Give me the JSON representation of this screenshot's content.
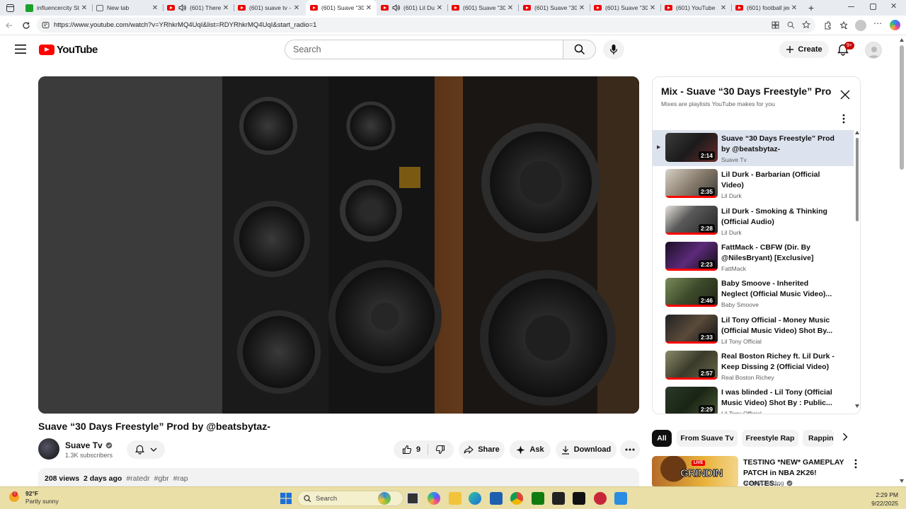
{
  "browser": {
    "tabs": [
      {
        "label": "influencercity St",
        "icon": "k-icon",
        "active": false
      },
      {
        "label": "New tab",
        "icon": "newtab-icon",
        "active": false
      },
      {
        "label": "(601) There",
        "icon": "youtube-icon",
        "audio": true,
        "active": false
      },
      {
        "label": "(601) suave tv - Y",
        "icon": "youtube-icon",
        "active": false
      },
      {
        "label": "(601) Suave “30",
        "icon": "youtube-icon",
        "active": true
      },
      {
        "label": "(601) Lil Du",
        "icon": "youtube-icon",
        "audio": true,
        "active": false
      },
      {
        "label": "(601) Suave “30",
        "icon": "youtube-icon",
        "active": false
      },
      {
        "label": "(601) Suave “30",
        "icon": "youtube-icon",
        "active": false
      },
      {
        "label": "(601) Suave “30",
        "icon": "youtube-icon",
        "active": false
      },
      {
        "label": "(601) YouTube",
        "icon": "youtube-icon",
        "active": false
      },
      {
        "label": "(601) football jer",
        "icon": "youtube-icon",
        "active": false
      }
    ],
    "close_glyph": "✕",
    "new_tab_glyph": "+",
    "url": "https://www.youtube.com/watch?v=YRhkrMQ4UqI&list=RDYRhkrMQ4UqI&start_radio=1"
  },
  "header": {
    "logo_text": "YouTube",
    "search_placeholder": "Search",
    "create_label": "Create",
    "notification_count": "9+"
  },
  "video": {
    "title": "Suave “30 Days Freestyle” Prod by @beatsbytaz-",
    "channel": "Suave Tv",
    "subscribers": "1.3K subscribers",
    "likes": "9",
    "share_label": "Share",
    "ask_label": "Ask",
    "download_label": "Download",
    "views": "208 views",
    "age": "2 days ago",
    "tags": [
      "#ratedr",
      "#gbr",
      "#rap"
    ]
  },
  "playlist": {
    "title": "Mix - Suave “30 Days Freestyle” Pro...",
    "subtitle": "Mixes are playlists YouTube makes for you",
    "current_indicator": "▶",
    "items": [
      {
        "title": "Suave “30 Days Freestyle” Prod by @beatsbytaz-",
        "channel": "Suave Tv",
        "duration": "2:14",
        "current": true
      },
      {
        "title": "Lil Durk - Barbarian (Official Video)",
        "channel": "Lil Durk",
        "duration": "2:35"
      },
      {
        "title": "Lil Durk - Smoking & Thinking (Official Audio)",
        "channel": "Lil Durk",
        "duration": "2:28"
      },
      {
        "title": "FattMack - CBFW (Dir. By @NilesBryant) [Exclusive]",
        "channel": "FattMack",
        "duration": "2:23"
      },
      {
        "title": "Baby Smoove - Inherited Neglect (Official Music Video)...",
        "channel": "Baby Smoove",
        "duration": "2:46"
      },
      {
        "title": "Lil Tony Official - Money Music (Official Music Video) Shot By...",
        "channel": "Lil Tony Official",
        "duration": "2:33"
      },
      {
        "title": "Real Boston Richey ft. Lil Durk - Keep Dissing 2 (Official Video)",
        "channel": "Real Boston Richey",
        "duration": "2:57"
      },
      {
        "title": "I was blinded - Lil Tony (Official Music Video) Shot By : Public...",
        "channel": "Lil Tony Official",
        "duration": "2:29"
      }
    ]
  },
  "chips": [
    "All",
    "From Suave Tv",
    "Freestyle Rap",
    "Rapping"
  ],
  "recommendation": {
    "title": "TESTING *NEW* GAMEPLAY PATCH in NBA 2K26! CONTES...",
    "channel": "SimplyGrinding",
    "thumb_text": "GRINDIN",
    "live_text": "LIVE"
  },
  "taskbar": {
    "temperature": "92°F",
    "condition": "Partly sunny",
    "search_label": "Search",
    "time": "2:29 PM",
    "date": "9/22/2025"
  }
}
